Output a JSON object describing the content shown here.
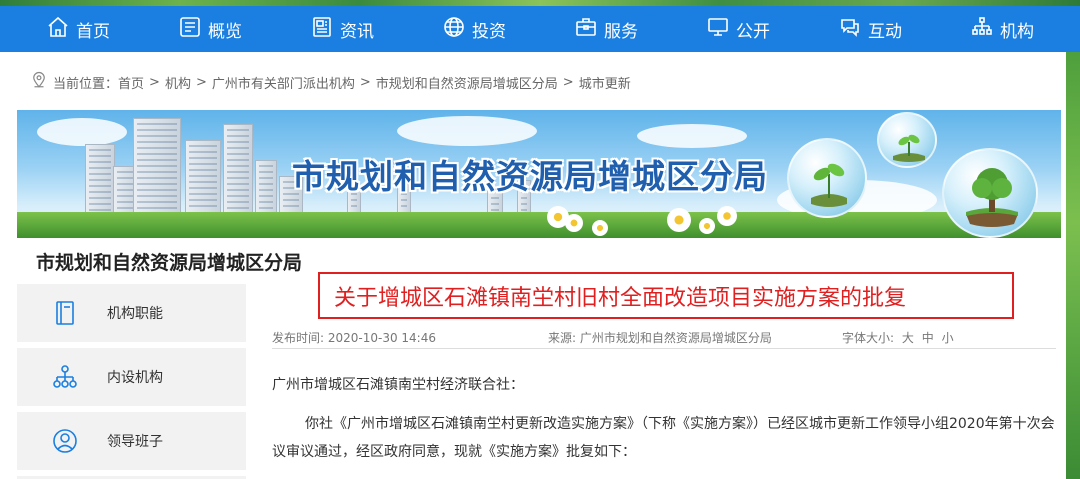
{
  "nav": {
    "items": [
      {
        "label": "首页",
        "icon": "home-icon"
      },
      {
        "label": "概览",
        "icon": "grid-icon"
      },
      {
        "label": "资讯",
        "icon": "news-icon"
      },
      {
        "label": "投资",
        "icon": "globe-icon"
      },
      {
        "label": "服务",
        "icon": "briefcase-icon"
      },
      {
        "label": "公开",
        "icon": "monitor-icon"
      },
      {
        "label": "互动",
        "icon": "chat-icon"
      },
      {
        "label": "机构",
        "icon": "org-icon"
      }
    ]
  },
  "breadcrumb": {
    "prefix": "当前位置：",
    "items": [
      "首页",
      "机构",
      "广州市有关部门派出机构",
      "市规划和自然资源局增城区分局",
      "城市更新"
    ],
    "separator": ">"
  },
  "banner": {
    "title": "市规划和自然资源局增城区分局"
  },
  "section": {
    "title": "市规划和自然资源局增城区分局"
  },
  "sidebar": {
    "items": [
      {
        "label": "机构职能",
        "icon": "book-icon"
      },
      {
        "label": "内设机构",
        "icon": "org-chart-icon"
      },
      {
        "label": "领导班子",
        "icon": "user-icon"
      }
    ]
  },
  "article": {
    "title": "关于增城区石滩镇南坣村旧村全面改造项目实施方案的批复",
    "publish_time": "发布时间: 2020-10-30 14:46",
    "source": "来源: 广州市规划和自然资源局增城区分局",
    "font_size_label": "字体大小:",
    "font_sizes": [
      "大",
      "中",
      "小"
    ],
    "salutation": "广州市增城区石滩镇南坣村经济联合社：",
    "body": "你社《广州市增城区石滩镇南坣村更新改造实施方案》（下称《实施方案》）已经区城市更新工作领导小组2020年第十次会议审议通过，经区政府同意，现就《实施方案》批复如下："
  },
  "colors": {
    "nav_bg": "#1a7fe0",
    "title_red": "#e02020",
    "banner_title": "#1f5fae"
  }
}
